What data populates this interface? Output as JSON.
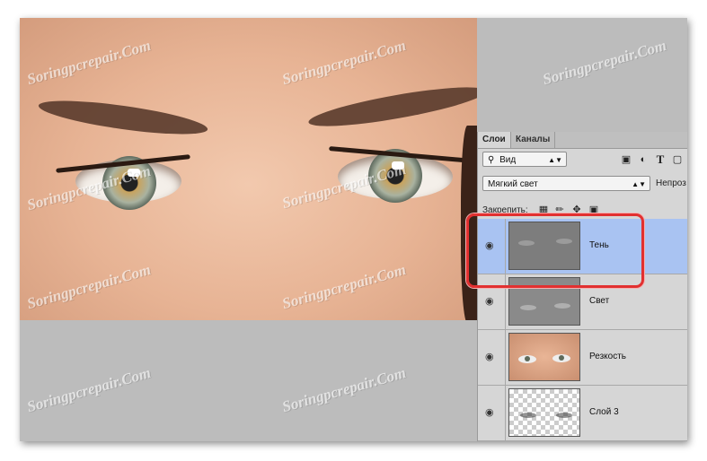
{
  "panel": {
    "tabs": [
      {
        "label": "Слои",
        "active": true
      },
      {
        "label": "Каналы",
        "active": false
      }
    ],
    "filter": {
      "value": "Вид"
    },
    "blend_mode": {
      "value": "Мягкий свет"
    },
    "opacity_label": "Непроз",
    "lock_label": "Закрепить:",
    "icons": [
      "search-icon",
      "image-filter-icon",
      "adjustment-filter-icon",
      "type-filter-icon",
      "shape-filter-icon"
    ],
    "layers": [
      {
        "name": "Тень",
        "selected": true,
        "visible": true,
        "thumbnail": "gray"
      },
      {
        "name": "Свет",
        "selected": false,
        "visible": true,
        "thumbnail": "gray"
      },
      {
        "name": "Резкость",
        "selected": false,
        "visible": true,
        "thumbnail": "photo"
      },
      {
        "name": "Слой 3",
        "selected": false,
        "visible": true,
        "thumbnail": "transparent"
      }
    ]
  },
  "watermark": "Soringpcrepair.Com",
  "colors": {
    "selected_layer": "#a9c3f2",
    "highlight": "#e23030",
    "panel_bg": "#d6d6d6"
  }
}
